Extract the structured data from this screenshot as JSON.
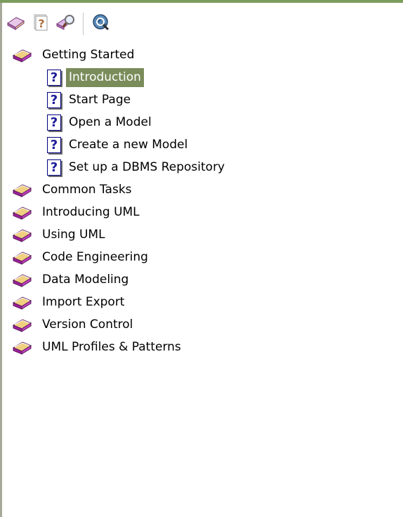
{
  "toolbar": {
    "buttons": [
      {
        "icon": "contents-book-icon"
      },
      {
        "icon": "help-question-icon"
      },
      {
        "icon": "search-index-icon"
      },
      {
        "icon": "web-globe-icon"
      }
    ]
  },
  "tree": {
    "selected": "Introduction",
    "nodes": [
      {
        "label": "Getting Started",
        "icon": "book-icon",
        "expanded": true,
        "children": [
          {
            "label": "Introduction",
            "icon": "help-page-icon"
          },
          {
            "label": "Start Page",
            "icon": "help-page-icon"
          },
          {
            "label": "Open a Model",
            "icon": "help-page-icon"
          },
          {
            "label": "Create a new Model",
            "icon": "help-page-icon"
          },
          {
            "label": "Set up a DBMS Repository",
            "icon": "help-page-icon"
          }
        ]
      },
      {
        "label": "Common Tasks",
        "icon": "book-icon"
      },
      {
        "label": "Introducing UML",
        "icon": "book-icon"
      },
      {
        "label": "Using UML",
        "icon": "book-icon"
      },
      {
        "label": "Code Engineering",
        "icon": "book-icon"
      },
      {
        "label": "Data Modeling",
        "icon": "book-icon"
      },
      {
        "label": "Import Export",
        "icon": "book-icon"
      },
      {
        "label": "Version Control",
        "icon": "book-icon"
      },
      {
        "label": "UML Profiles & Patterns",
        "icon": "book-icon"
      }
    ]
  },
  "colors": {
    "selection": "#7a8c5a",
    "book_purple": "#a020a0",
    "book_pages": "#f0c060",
    "help_blue": "#1a1a9a",
    "top_border": "#7c9c5c"
  }
}
